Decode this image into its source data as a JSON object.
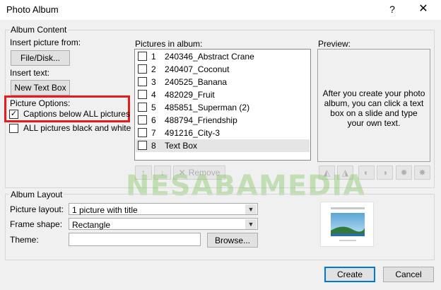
{
  "window": {
    "title": "Photo Album",
    "help_glyph": "?",
    "close_glyph": "✕"
  },
  "album_content": {
    "legend": "Album Content",
    "insert_picture_label": "Insert picture from:",
    "file_disk_button": "File/Disk...",
    "insert_text_label": "Insert text:",
    "new_text_box_button": "New Text Box",
    "picture_options_label": "Picture Options:",
    "captions_option": {
      "label": "Captions below ALL pictures",
      "checked": true
    },
    "black_white_option": {
      "label": "ALL pictures black and white",
      "checked": false
    }
  },
  "pictures": {
    "label": "Pictures in album:",
    "items": [
      {
        "num": "1",
        "name": "240346_Abstract Crane"
      },
      {
        "num": "2",
        "name": "240407_Coconut"
      },
      {
        "num": "3",
        "name": "240525_Banana"
      },
      {
        "num": "4",
        "name": "482029_Fruit"
      },
      {
        "num": "5",
        "name": "485851_Superman (2)"
      },
      {
        "num": "6",
        "name": "488794_Friendship"
      },
      {
        "num": "7",
        "name": "491216_City-3"
      },
      {
        "num": "8",
        "name": "Text Box"
      }
    ],
    "selected_index": 7,
    "move_up_glyph": "↑",
    "move_down_glyph": "↓",
    "remove_label": "Remove",
    "remove_glyph": "✕"
  },
  "preview": {
    "label": "Preview:",
    "text": "After you create your photo album, you can click a text box on a slide and type your own text."
  },
  "album_layout": {
    "legend": "Album Layout",
    "picture_layout_label": "Picture layout:",
    "picture_layout_value": "1 picture with title",
    "frame_shape_label": "Frame shape:",
    "frame_shape_value": "Rectangle",
    "theme_label": "Theme:",
    "theme_value": "",
    "browse_button": "Browse..."
  },
  "footer": {
    "create_button": "Create",
    "cancel_button": "Cancel"
  },
  "watermark": "NESABAMEDIA",
  "colors": {
    "highlight": "#e41c1c",
    "watermark": "#6fbf4a",
    "accent": "#0078d7"
  }
}
